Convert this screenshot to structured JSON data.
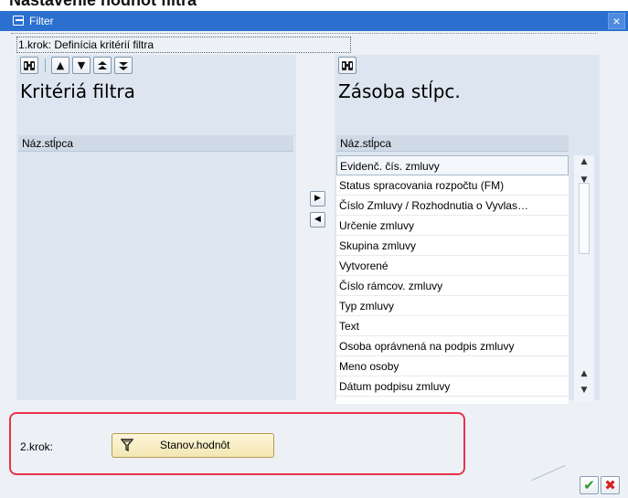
{
  "page": {
    "heading": "Nastavenie hodnôt filtra"
  },
  "window": {
    "title": "Filter",
    "close_glyph": "×"
  },
  "step1": {
    "label": "1.krok: Definícia kritérií filtra"
  },
  "left_panel": {
    "title": "Kritériá filtra",
    "column_header": "Náz.stĺpca",
    "toolbar": {
      "find_icon": "find-icon",
      "buttons": [
        "move-up-icon",
        "move-down-icon",
        "move-top-icon",
        "move-bottom-icon"
      ]
    }
  },
  "right_panel": {
    "title": "Zásoba stĺpc.",
    "column_header": "Náz.stĺpca",
    "toolbar": {
      "find_icon": "find-icon"
    },
    "items": [
      "Evidenč. čís. zmluvy",
      "Status spracovania rozpočtu (FM)",
      "Číslo Zmluvy / Rozhodnutia o Vyvlas…",
      "Určenie zmluvy",
      "Skupina zmluvy",
      "Vytvorené",
      "Číslo rámcov. zmluvy",
      "Typ zmluvy",
      "Text",
      "Osoba oprávnená na podpis zmluvy",
      "Meno osoby",
      "Dátum podpisu zmluvy"
    ]
  },
  "transfer": {
    "add_glyph": "▶",
    "remove_glyph": "◀"
  },
  "step2": {
    "label": "2.krok:",
    "button_label": "Stanov.hodnôt"
  },
  "footer": {
    "ok_glyph": "✔",
    "cancel_glyph": "✖"
  },
  "colors": {
    "titlebar": "#2b6fcf",
    "panel": "#dde6f0",
    "highlight": "#e8334a"
  }
}
